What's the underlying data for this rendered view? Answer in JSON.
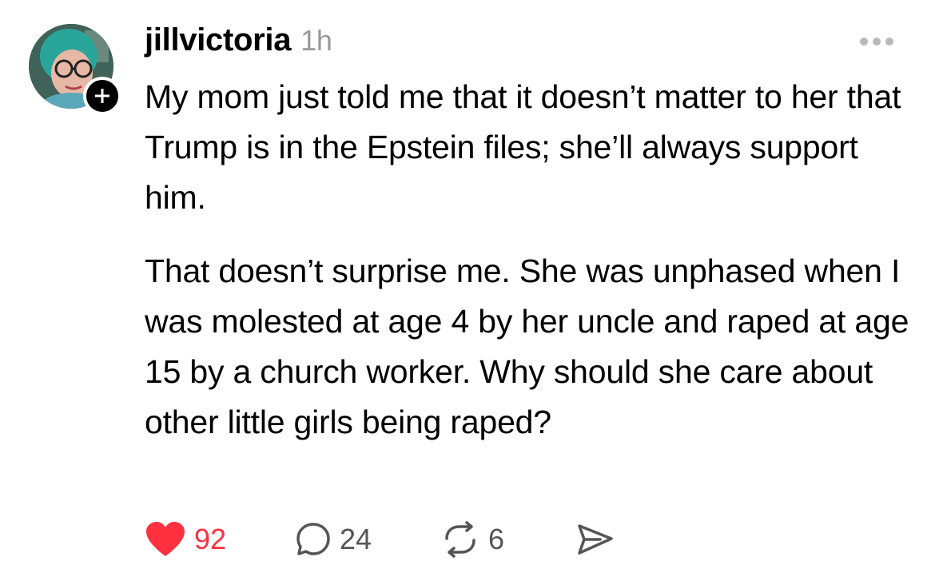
{
  "post": {
    "username": "jillvictoria",
    "timestamp": "1h",
    "body_paragraphs": [
      "My mom just told me that it doesn’t matter to her that Trump is in the Epstein files; she’ll always support him.",
      "That doesn’t surprise me. She was unphased when I was molested at age 4 by her uncle and raped at age 15 by a church worker. Why should she care about other little girls being raped?"
    ],
    "stats": {
      "likes": "92",
      "comments": "24",
      "reposts": "6"
    }
  },
  "colors": {
    "like_red": "#ff3040",
    "timestamp_gray": "#999999",
    "text_black": "#000000"
  },
  "icons": {
    "more": "more-icon",
    "follow": "plus-icon",
    "like": "heart-icon",
    "comment": "comment-icon",
    "repost": "repost-icon",
    "share": "share-icon"
  }
}
